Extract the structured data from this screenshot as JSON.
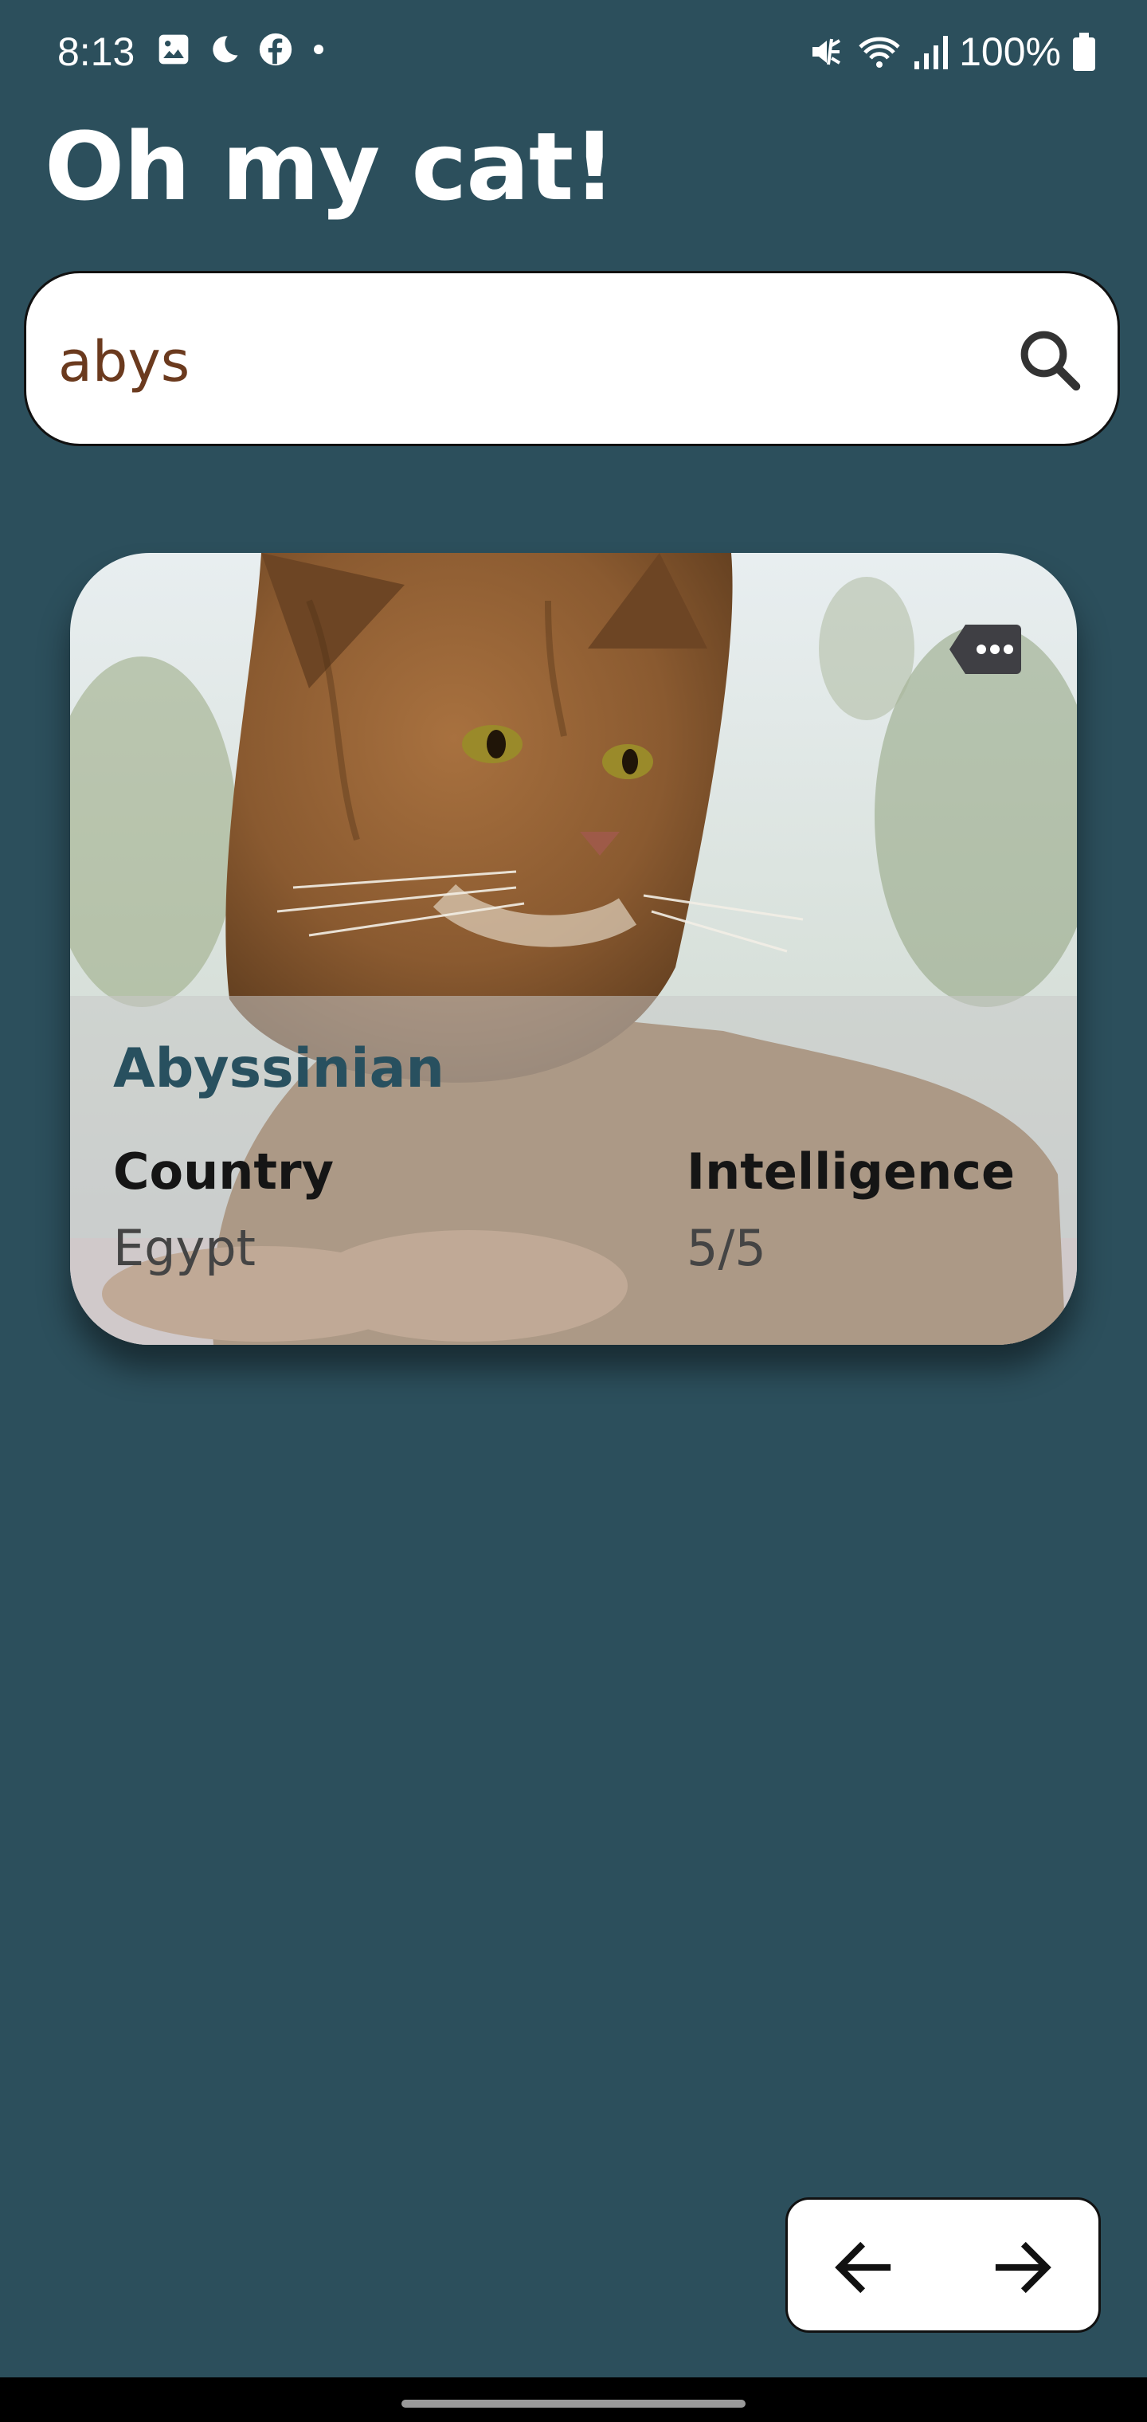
{
  "status_bar": {
    "time": "8:13",
    "battery_text": "100%",
    "left_icons": [
      "gallery-icon",
      "moon-icon",
      "facebook-icon",
      "dot-icon"
    ],
    "right_icons": [
      "mute-icon",
      "wifi-icon",
      "signal-icon",
      "battery-icon"
    ]
  },
  "app": {
    "title": "Oh my cat!"
  },
  "search": {
    "value": "abys",
    "icon": "search-icon"
  },
  "card": {
    "breed": "Abyssinian",
    "country_label": "Country",
    "country_value": "Egypt",
    "intelligence_label": "Intelligence",
    "intelligence_value": "5/5",
    "more_icon": "more-tag-icon"
  },
  "pager": {
    "prev_icon": "arrow-left-icon",
    "next_icon": "arrow-right-icon"
  },
  "colors": {
    "background": "#2c4f5c",
    "accent": "#28505f",
    "search_text": "#6b3a1e",
    "card_overlay": "#c8c8c8"
  }
}
